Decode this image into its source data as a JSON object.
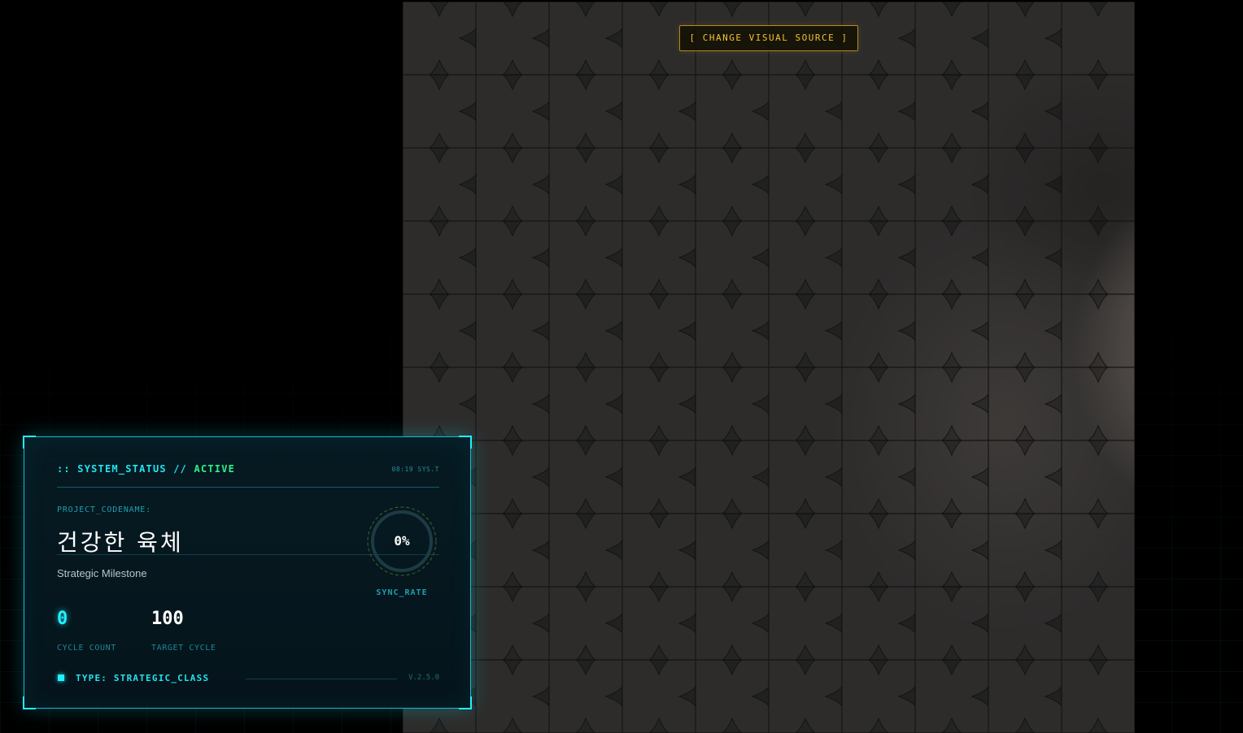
{
  "board": {
    "image_alt": "puzzle image",
    "change_source_label": "[ CHANGE VISUAL SOURCE ]",
    "grid": {
      "rows": 10,
      "cols": 10
    }
  },
  "status_panel": {
    "header_prefix": ":: SYSTEM_STATUS // ",
    "header_state": "ACTIVE",
    "time": "08:19 SYS.T",
    "codename_label": "PROJECT_CODENAME:",
    "codename": "건강한 육체",
    "subtitle": "Strategic Milestone",
    "sync_rate": "0%",
    "sync_label": "SYNC_RATE",
    "cycle_count_value": "0",
    "cycle_count_label": "CYCLE COUNT",
    "target_cycle_value": "100",
    "target_cycle_label": "TARGET CYCLE",
    "type_label": "TYPE: STRATEGIC_CLASS",
    "version": "V.2.5.0"
  },
  "colors": {
    "accent_cyan": "#22f0ff",
    "active_green": "#2ef08a",
    "button_gold": "#f2c230",
    "panel_bg": "#061a22"
  }
}
